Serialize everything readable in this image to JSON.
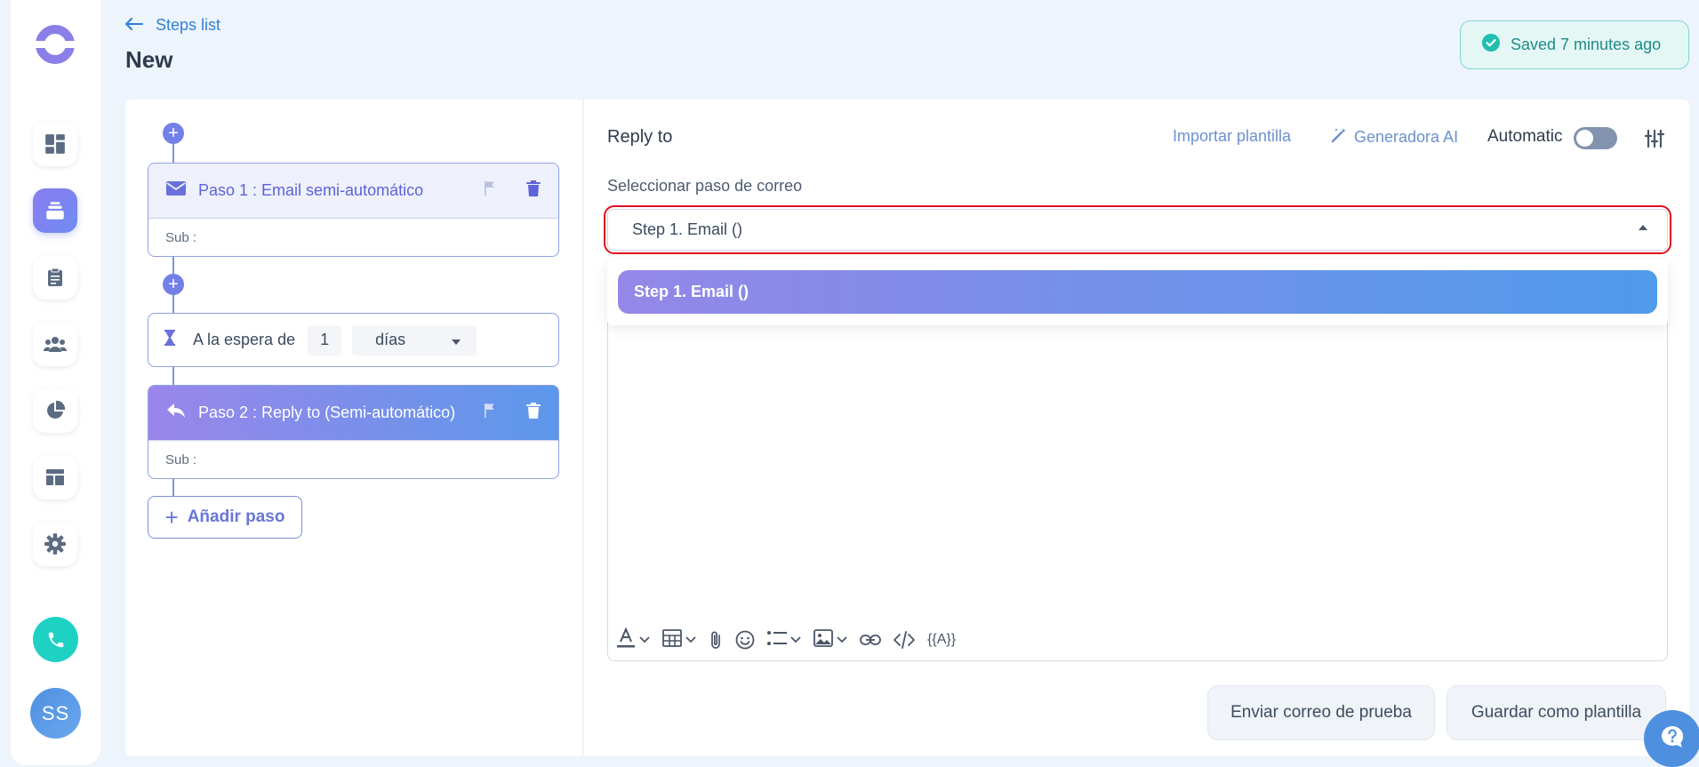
{
  "header": {
    "back_label": "Steps list",
    "page_title": "New",
    "saved_status": "Saved 7 minutes ago"
  },
  "sidebar": {
    "items": [
      {
        "icon": "dashboard-icon",
        "active": false
      },
      {
        "icon": "sequences-icon",
        "active": true
      },
      {
        "icon": "clipboard-icon",
        "active": false
      },
      {
        "icon": "users-icon",
        "active": false
      },
      {
        "icon": "pie-chart-icon",
        "active": false
      },
      {
        "icon": "layout-icon",
        "active": false
      },
      {
        "icon": "gear-icon",
        "active": false
      }
    ],
    "phone_icon": "phone-icon",
    "avatar_initials": "SS"
  },
  "steps": {
    "step1": {
      "title": "Paso 1 : Email semi-automático",
      "sub": "Sub :"
    },
    "wait": {
      "label": "A la espera de",
      "value": "1",
      "unit": "días"
    },
    "step2": {
      "title": "Paso 2 : Reply to (Semi-automático)",
      "sub": "Sub :"
    },
    "add_label": "Añadir paso"
  },
  "editor": {
    "title": "Reply to",
    "import_label": "Importar plantilla",
    "ai_label": "Generadora AI",
    "automatic_label": "Automatic",
    "automatic_on": false,
    "select_label": "Seleccionar paso de correo",
    "selected_value": "Step 1. Email ()",
    "dropdown_options": [
      "Step 1. Email ()"
    ],
    "toolbar_variable": "{{A}}"
  },
  "actions": {
    "test_email": "Enviar correo de prueba",
    "save_template": "Guardar como plantilla"
  },
  "colors": {
    "accent": "#7380e8",
    "link": "#2f7fd8",
    "saved_bg": "#e4f7f5",
    "highlight": "#e0101f"
  }
}
